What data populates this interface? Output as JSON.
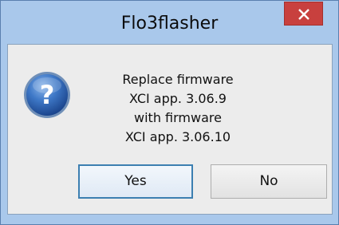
{
  "window": {
    "title": "Flo3flasher",
    "close_icon": "close-icon"
  },
  "dialog": {
    "icon": "question-icon",
    "message_lines": [
      "Replace firmware",
      "XCI app. 3.06.9",
      "with firmware",
      "XCI app. 3.06.10"
    ],
    "buttons": {
      "yes_label": "Yes",
      "no_label": "No"
    }
  },
  "colors": {
    "frame": "#a9c8eb",
    "close_button": "#c8403e",
    "client_background": "#ececec",
    "default_button_border": "#3c7fb1"
  }
}
